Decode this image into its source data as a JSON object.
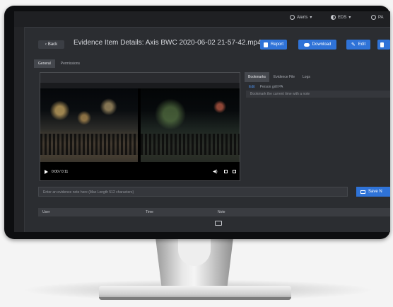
{
  "topbar": {
    "alerts_label": "Alerts",
    "org_label": "EDS",
    "user_label": "PA"
  },
  "header": {
    "back_label": "Back",
    "title": "Evidence Item Details: Axis BWC 2020-06-02 21-57-42.mp4",
    "actions": [
      {
        "label": "Report",
        "icon": "report-icon"
      },
      {
        "label": "Download",
        "icon": "cloud-download-icon"
      },
      {
        "label": "Edit",
        "icon": "pencil-icon"
      },
      {
        "label": "Del",
        "icon": "trash-icon"
      }
    ]
  },
  "main_tabs": [
    {
      "label": "General",
      "active": true
    },
    {
      "label": "Permissions",
      "active": false
    }
  ],
  "player": {
    "time": "0:00 / 0:11"
  },
  "right_panel": {
    "tabs": [
      {
        "label": "Bookmarks",
        "active": true
      },
      {
        "label": "Evidence File",
        "active": false
      },
      {
        "label": "Logs",
        "active": false
      }
    ],
    "subtabs": [
      "Edit",
      "Person grill PA"
    ],
    "bookmark_placeholder": "Bookmark the current time with a note"
  },
  "note": {
    "placeholder": "Enter an evidence note here (Max Length 512 characters)",
    "save_label": "Save N"
  },
  "table": {
    "columns": [
      "User",
      "Time",
      "Note"
    ]
  },
  "colors": {
    "accent": "#2f73d8",
    "background": "#2b2d31",
    "monitor_bezel": "#0d0e10"
  }
}
